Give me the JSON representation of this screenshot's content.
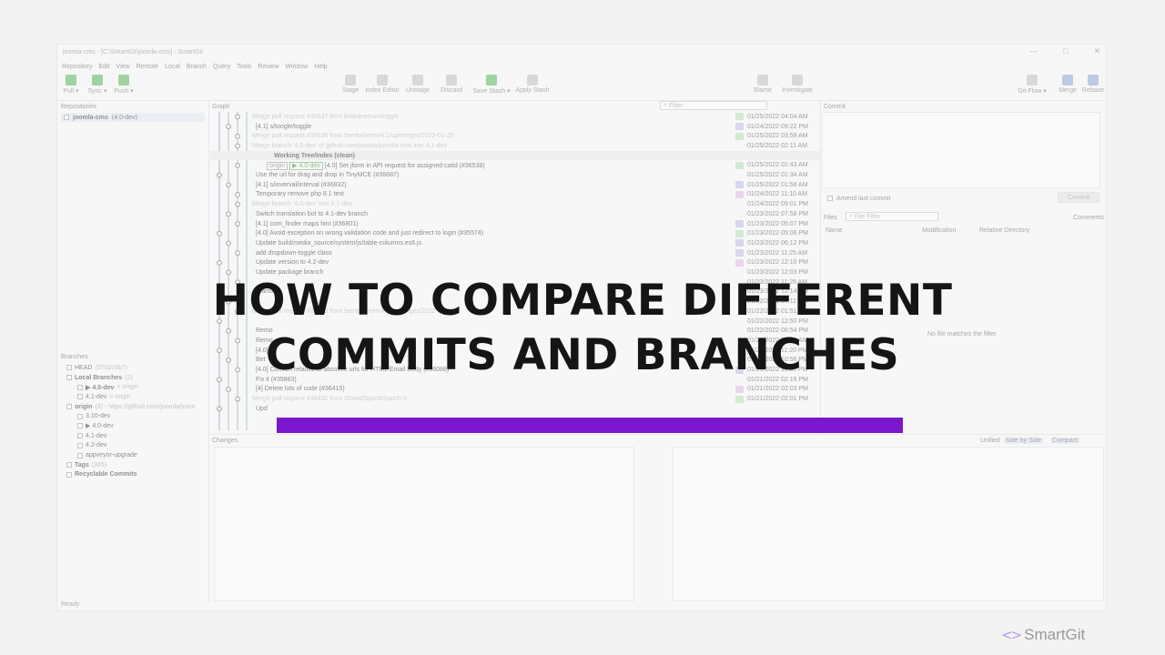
{
  "window": {
    "title": "joomla-cms - [C:\\SmartGit\\joomla-cms] - SmartGit",
    "buttons": [
      "—",
      "□",
      "✕"
    ]
  },
  "menu": [
    "Repository",
    "Edit",
    "View",
    "Remote",
    "Local",
    "Branch",
    "Query",
    "Tools",
    "Review",
    "Window",
    "Help"
  ],
  "toolbar": {
    "pull": "Pull ▾",
    "sync": "Sync ▾",
    "push": "Push ▾",
    "stage": "Stage",
    "index_editor": "Index Editor",
    "unstage": "Unstage",
    "discard": "Discard",
    "save_stash": "Save Stash ▾",
    "apply_stash": "Apply Stash",
    "blame": "Blame",
    "investigate": "Investigate",
    "git_flow": "Git-Flow ▾",
    "merge": "Merge",
    "rebase": "Rebase"
  },
  "repositories": {
    "title": "Repositories",
    "item": "joomla-cms",
    "item_branch": "(4.0-dev)"
  },
  "graph": {
    "title": "Graph",
    "filter_placeholder": "Filter",
    "rows": [
      {
        "msg": "Merge pull request #36637 from brianteeman/toggle",
        "dim": true,
        "date": "01/25/2022 04:04 AM",
        "av": "#bfe3bf"
      },
      {
        "msg": "[4.1] s/toogle/toggle",
        "date": "01/24/2022 09:22 PM",
        "av": "#c7c7ea"
      },
      {
        "msg": "Merge pull request #36636 from bembelimen/4.1/upmerges/2022-01-25",
        "dim": true,
        "date": "01/25/2022 03:59 AM",
        "av": "#bfe3bf"
      },
      {
        "msg": "Merge branch '4.0-dev' of github.com/joomla/joomla-cms into 4.1-dev",
        "dim": true,
        "date": "01/25/2022 02:11 AM",
        "av": ""
      },
      {
        "msg": "Working Tree/Index (clean)",
        "sel": true,
        "date": "",
        "av": ""
      },
      {
        "tags": [
          "origin",
          "▶ 4.0-dev"
        ],
        "msg": "[4.0] Set jform in API request for assigned catid (#36538)",
        "date": "01/25/2022 01:43 AM",
        "av": "#bfe3bf"
      },
      {
        "msg": "Use the url for drag and drop in TinyMCE (#36687)",
        "date": "01/25/2022 01:34 AM",
        "av": ""
      },
      {
        "msg": "[4.1] s/inverval/interval (#36832)",
        "date": "01/25/2022 01:58 AM",
        "av": "#c7c7ea"
      },
      {
        "msg": "Temporary remove php 8.1 test",
        "date": "01/24/2022 11:10 AM",
        "av": "#e6c4ea"
      },
      {
        "msg": "Merge branch '4.0-dev' into 4.1-dev",
        "dim": true,
        "date": "01/24/2022 09:01 PM",
        "av": ""
      },
      {
        "msg": "Switch translation bot to 4.1-dev branch",
        "date": "01/23/2022 07:58 PM",
        "av": ""
      },
      {
        "msg": "[4.1] com_finder maps hint (#36801)",
        "date": "01/23/2022 05:07 PM",
        "av": "#c7c7ea"
      },
      {
        "msg": "[4.0] Avoid exception on wrong validation code and just redirect to login (#35574)",
        "date": "01/23/2022 05:06 PM",
        "av": "#bfe3bf"
      },
      {
        "msg": "Update build/media_source/system/js/table-columns.es6.js",
        "date": "01/23/2022 06:12 PM",
        "av": "#c7c7ea"
      },
      {
        "msg": "add dropdown-toggle class",
        "date": "01/23/2022 11:25 AM",
        "av": "#c7c7ea"
      },
      {
        "msg": "Update version to 4.2-dev",
        "date": "01/23/2022 12:10 PM",
        "av": "#e6c4ea"
      },
      {
        "msg": "Update package branch",
        "date": "01/23/2022 12:03 PM",
        "av": ""
      },
      {
        "msg": "",
        "date": "01/23/2022 11:25 AM",
        "av": ""
      },
      {
        "msg": "Translat",
        "date": "01/23/2022 12:14 PM",
        "av": ""
      },
      {
        "msg": "",
        "date": "01/22/2022 07:11 AM",
        "av": ""
      },
      {
        "msg": "Merge pull request #36790 from bembelimen/4.1/upmerges/2022-01-22",
        "dim": true,
        "date": "01/22/2022 01:51 AM",
        "av": ""
      },
      {
        "msg": "",
        "date": "01/22/2022 12:50 PM",
        "av": ""
      },
      {
        "msg": "Remo",
        "date": "01/22/2022 08:54 PM",
        "av": ""
      },
      {
        "msg": "Remo",
        "date": "01/22/2022 08:23 AM",
        "av": ""
      },
      {
        "msg": "[4.0]",
        "date": "01/21/2022 11:20 PM",
        "av": ""
      },
      {
        "msg": "Bet",
        "date": "01/21/2022 10:56 PM",
        "av": ""
      },
      {
        "msg": "[4.0] Convert relative to absolute urls for HTML Email Body (#36088)",
        "date": "01/21/2022 11:05 PM",
        "av": "#c7c7ea"
      },
      {
        "msg": "Fix it (#35883)",
        "date": "01/21/2022 02:16 PM",
        "av": ""
      },
      {
        "msg": "[4] Delete lots of code (#36415)",
        "date": "01/21/2022 02:03 PM",
        "av": "#e6c4ea"
      },
      {
        "msg": "Merge pull request #36432 from itDavidSpacer/patch-9",
        "dim": true,
        "date": "01/21/2022 02:01 PM",
        "av": "#bfe3bf"
      },
      {
        "msg": "Upd",
        "date": "",
        "av": ""
      }
    ]
  },
  "branches": {
    "title": "Branches",
    "rows": [
      {
        "label": "HEAD",
        "extra": "(3702c5b7)",
        "indent": 0,
        "bold": false
      },
      {
        "label": "Local Branches",
        "extra": "(2)",
        "indent": 0,
        "bold": true
      },
      {
        "label": "▶ 4.0-dev",
        "extra": "= origin",
        "indent": 1,
        "bold": true
      },
      {
        "label": "4.1-dev",
        "extra": "= origin",
        "indent": 1,
        "bold": false
      },
      {
        "label": "origin",
        "extra": "(3) - https://github.com/joomla/joom",
        "indent": 0,
        "bold": true
      },
      {
        "label": "3.10-dev",
        "extra": "",
        "indent": 1,
        "bold": false
      },
      {
        "label": "▶ 4.0-dev",
        "extra": "",
        "indent": 1,
        "bold": false
      },
      {
        "label": "4.1-dev",
        "extra": "",
        "indent": 1,
        "bold": false
      },
      {
        "label": "4.2-dev",
        "extra": "",
        "indent": 1,
        "bold": false
      },
      {
        "label": "appveyor-upgrade",
        "extra": "",
        "indent": 1,
        "bold": false
      },
      {
        "label": "Tags",
        "extra": "(345)",
        "indent": 0,
        "bold": true
      },
      {
        "label": "Recyclable Commits",
        "extra": "",
        "indent": 0,
        "bold": true
      }
    ]
  },
  "commit": {
    "title": "Commit",
    "amend": "Amend last commit",
    "button": "Commit"
  },
  "files": {
    "title": "Files",
    "filter_placeholder": "File Filter",
    "comments": "Comments",
    "columns": [
      "Name",
      "Modification",
      "Relative Directory"
    ],
    "empty": "No file matches the filter."
  },
  "changes": {
    "title": "Changes",
    "unified": "Unified",
    "side_by_side": "Side by Side",
    "compact": "Compact"
  },
  "status": "Ready",
  "overlay": {
    "line1": "HOW TO COMPARE DIFFERENT",
    "line2": "COMMITS AND BRANCHES",
    "bar_color": "#7b17cf"
  },
  "brand": {
    "mark": "<>",
    "name": "SmartGit"
  }
}
